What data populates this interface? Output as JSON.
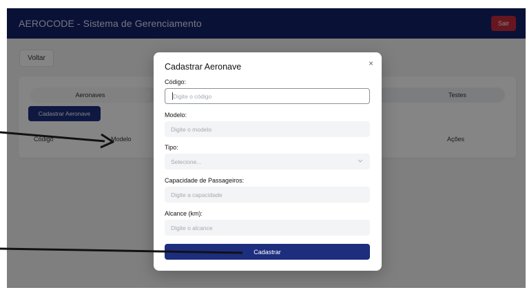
{
  "header": {
    "title": "AEROCODE - Sistema de Gerenciamento",
    "logout_label": "Sair"
  },
  "page": {
    "back_label": "Voltar"
  },
  "tabs": [
    {
      "label": "Aeronaves"
    },
    {
      "label": "Testes"
    }
  ],
  "toolbar": {
    "register_label": "Cadastrar Aeronave"
  },
  "table": {
    "columns": [
      "Código",
      "Modelo",
      "Ações"
    ]
  },
  "modal": {
    "title": "Cadastrar Aeronave",
    "close_symbol": "×",
    "fields": [
      {
        "label": "Código:",
        "placeholder": "Digite o código"
      },
      {
        "label": "Modelo:",
        "placeholder": "Digite o modelo"
      },
      {
        "label": "Tipo:",
        "placeholder": "Selecione..."
      },
      {
        "label": "Capacidade de Passageiros:",
        "placeholder": "Digite a capacidade"
      },
      {
        "label": "Alcance (km):",
        "placeholder": "Digite o alcance"
      }
    ],
    "submit_label": "Cadastrar"
  },
  "colors": {
    "header_bg": "#13226a",
    "primary": "#1c2e7d",
    "danger": "#c62b3d"
  },
  "icons": {
    "close": "close-icon",
    "select": "chevron-down-icon",
    "annotation": "arrow-icon"
  }
}
